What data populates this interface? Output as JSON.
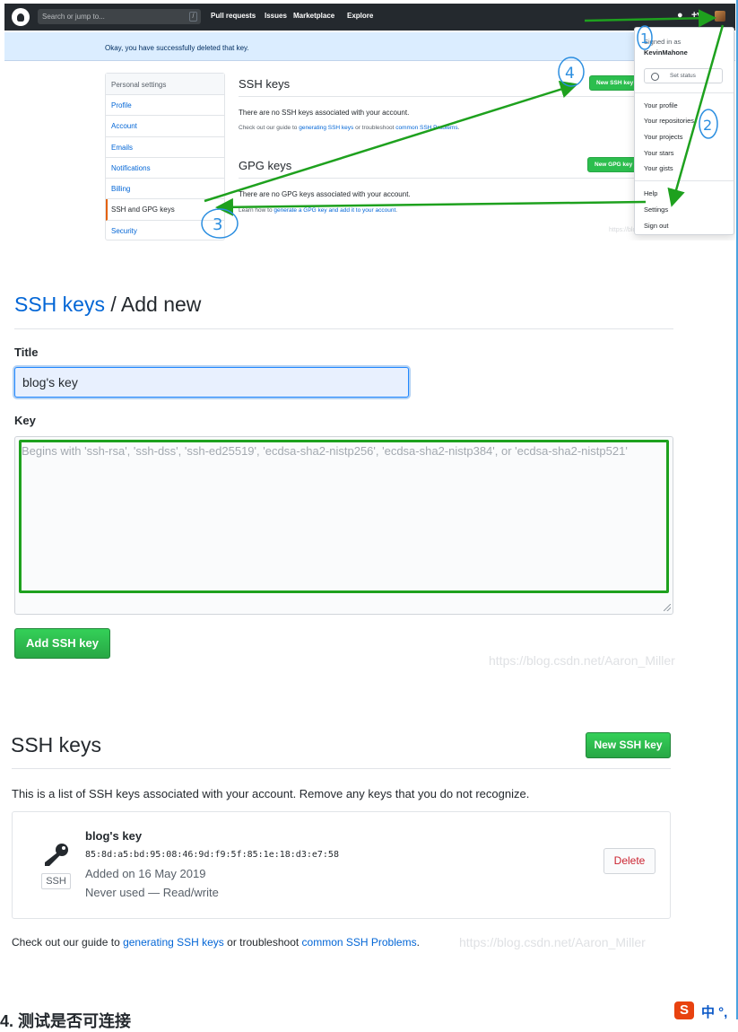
{
  "github_header": {
    "search_placeholder": "Search or jump to...",
    "search_hotkey": "/",
    "nav": [
      "Pull requests",
      "Issues",
      "Marketplace",
      "Explore"
    ],
    "icons": [
      "github-logo-icon",
      "bell-icon",
      "plus-icon",
      "avatar"
    ]
  },
  "flash": {
    "message": "Okay, you have successfully deleted that key."
  },
  "settings_menu": {
    "heading": "Personal settings",
    "items": [
      "Profile",
      "Account",
      "Emails",
      "Notifications",
      "Billing",
      "SSH and GPG keys",
      "Security"
    ],
    "selected": "SSH and GPG keys"
  },
  "panel_ssh": {
    "title": "SSH keys",
    "new_button": "New SSH key",
    "empty": "There are no SSH keys associated with your account.",
    "guide_prefix": "Check out our guide to ",
    "guide_link1": "generating SSH keys",
    "guide_mid": " or troubleshoot ",
    "guide_link2": "common SSH Problems",
    "guide_suffix": "."
  },
  "panel_gpg": {
    "title": "GPG keys",
    "new_button": "New GPG key",
    "empty": "There are no GPG keys associated with your account.",
    "learn_prefix": "Learn how to ",
    "learn_link": "generate a GPG key and add it to your account",
    "learn_suffix": "."
  },
  "user_dropdown": {
    "signed_in_as": "Signed in as",
    "username": "KevinMahone",
    "set_status": "Set status",
    "items1": [
      "Your profile",
      "Your repositories",
      "Your projects",
      "Your stars",
      "Your gists"
    ],
    "items2": [
      "Help",
      "Settings",
      "Sign out"
    ]
  },
  "annotations": {
    "marks": [
      "1",
      "2",
      "3",
      "4"
    ],
    "color": "#1ea11e",
    "circle_color": "#2b8ee0"
  },
  "watermark": "https://blog.csdn.net/Aaron_Miller",
  "form": {
    "breadcrumb_link": "SSH keys",
    "breadcrumb_sep": " / ",
    "breadcrumb_current": "Add new",
    "title_label": "Title",
    "title_value": "blog's key",
    "key_label": "Key",
    "key_placeholder": "Begins with 'ssh-rsa', 'ssh-dss', 'ssh-ed25519', 'ecdsa-sha2-nistp256', 'ecdsa-sha2-nistp384', or 'ecdsa-sha2-nistp521'",
    "submit_label": "Add SSH key"
  },
  "keys_list": {
    "title": "SSH keys",
    "new_button": "New SSH key",
    "description": "This is a list of SSH keys associated with your account. Remove any keys that you do not recognize.",
    "items": [
      {
        "name": "blog's key",
        "fingerprint": "85:8d:a5:bd:95:08:46:9d:f9:5f:85:1e:18:d3:e7:58",
        "added": "Added on 16 May 2019",
        "usage": "Never used — Read/write",
        "type_badge": "SSH",
        "delete_label": "Delete"
      }
    ],
    "footer_prefix": "Check out our guide to ",
    "footer_link1": "generating SSH keys",
    "footer_mid": " or troubleshoot ",
    "footer_link2": "common SSH Problems",
    "footer_suffix": "."
  },
  "bottom_heading": "4. 测试是否可连接",
  "ime": {
    "logo": "S",
    "mode": "中 °,"
  }
}
